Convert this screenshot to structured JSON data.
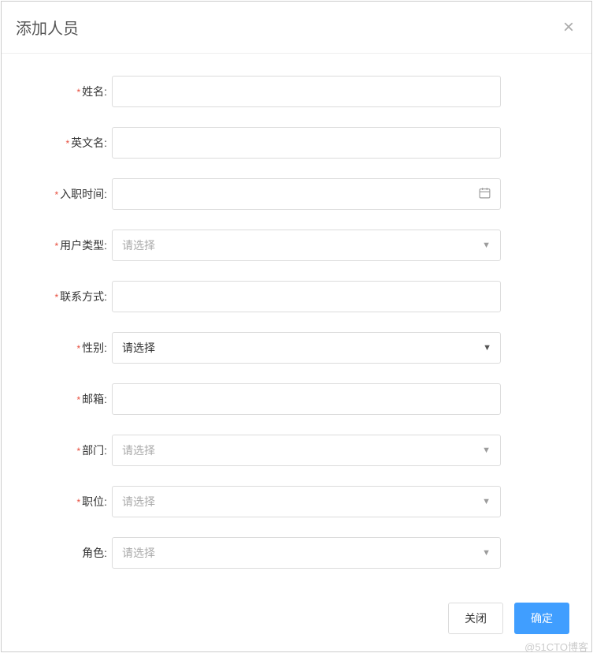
{
  "modal": {
    "title": "添加人员",
    "close_label": "×"
  },
  "form": {
    "fields": {
      "name": {
        "label": "姓名:",
        "required": true,
        "value": ""
      },
      "english_name": {
        "label": "英文名:",
        "required": true,
        "value": ""
      },
      "join_date": {
        "label": "入职时间:",
        "required": true,
        "value": ""
      },
      "user_type": {
        "label": "用户类型:",
        "required": true,
        "placeholder": "请选择"
      },
      "contact": {
        "label": "联系方式:",
        "required": true,
        "value": ""
      },
      "gender": {
        "label": "性别:",
        "required": true,
        "placeholder": "请选择"
      },
      "email": {
        "label": "邮箱:",
        "required": true,
        "value": ""
      },
      "department": {
        "label": "部门:",
        "required": true,
        "placeholder": "请选择"
      },
      "position": {
        "label": "职位:",
        "required": true,
        "placeholder": "请选择"
      },
      "role": {
        "label": "角色:",
        "required": false,
        "placeholder": "请选择"
      }
    }
  },
  "footer": {
    "close": "关闭",
    "confirm": "确定"
  },
  "watermark": "@51CTO博客",
  "star": "*"
}
